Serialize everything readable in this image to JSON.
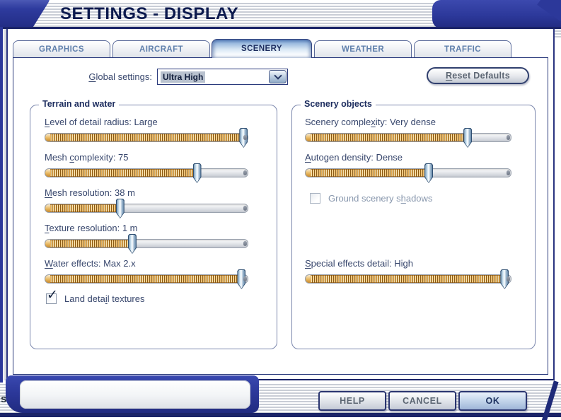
{
  "title": "SETTINGS - DISPLAY",
  "tabs": [
    {
      "label": "GRAPHICS",
      "active": false
    },
    {
      "label": "AIRCRAFT",
      "active": false
    },
    {
      "label": "SCENERY",
      "active": true
    },
    {
      "label": "WEATHER",
      "active": false
    },
    {
      "label": "TRAFFIC",
      "active": false
    }
  ],
  "toolbar": {
    "global_label": {
      "pre": "",
      "key": "G",
      "post": "lobal settings:"
    },
    "global_value": "Ultra High",
    "reset_button": {
      "pre": "",
      "key": "R",
      "post": "eset Defaults"
    }
  },
  "terrain": {
    "legend": "Terrain and water",
    "sliders": [
      {
        "pre": "",
        "key": "L",
        "post": "evel of detail radius: Large",
        "value_text": "Large",
        "pct": 98
      },
      {
        "pre": "Mesh ",
        "key": "c",
        "post": "omplexity: 75",
        "value_text": "75",
        "pct": 75
      },
      {
        "pre": "",
        "key": "M",
        "post": "esh resolution: 38 m",
        "value_text": "38 m",
        "pct": 37
      },
      {
        "pre": "",
        "key": "T",
        "post": "exture resolution: 1 m",
        "value_text": "1 m",
        "pct": 43
      },
      {
        "pre": "",
        "key": "W",
        "post": "ater effects: Max 2.x",
        "value_text": "Max 2.x",
        "pct": 97
      }
    ],
    "checkbox": {
      "pre": "Land deta",
      "key": "i",
      "post": "l textures",
      "checked": true,
      "mark": "✓"
    }
  },
  "scenery": {
    "legend": "Scenery objects",
    "sliders": [
      {
        "pre": "Scenery comple",
        "key": "x",
        "post": "ity: Very dense",
        "value_text": "Very dense",
        "pct": 79
      },
      {
        "pre": "",
        "key": "A",
        "post": "utogen density: Dense",
        "value_text": "Dense",
        "pct": 60
      },
      {
        "pre": "",
        "key": "S",
        "post": "pecial effects detail: High",
        "value_text": "High",
        "pct": 97
      }
    ],
    "checkbox": {
      "pre": "Ground scenery s",
      "key": "h",
      "post": "adows",
      "checked": false,
      "disabled": true
    }
  },
  "footer": {
    "help": "HELP",
    "cancel": "CANCEL",
    "ok": "OK"
  },
  "misc": {
    "clipped_text": "s"
  },
  "colors": {
    "navy": "#2c389a",
    "dark_navy_line": "#1b2468",
    "dialog_border": "#2a3480",
    "slider_orange": "#e9b35c",
    "thumb_blue": "#9cb8d0",
    "active_tab_blue": "#5f87c0",
    "label_text": "#37466c",
    "disabled_text": "#8897ad",
    "selection_highlight": "#b9c2cf"
  }
}
